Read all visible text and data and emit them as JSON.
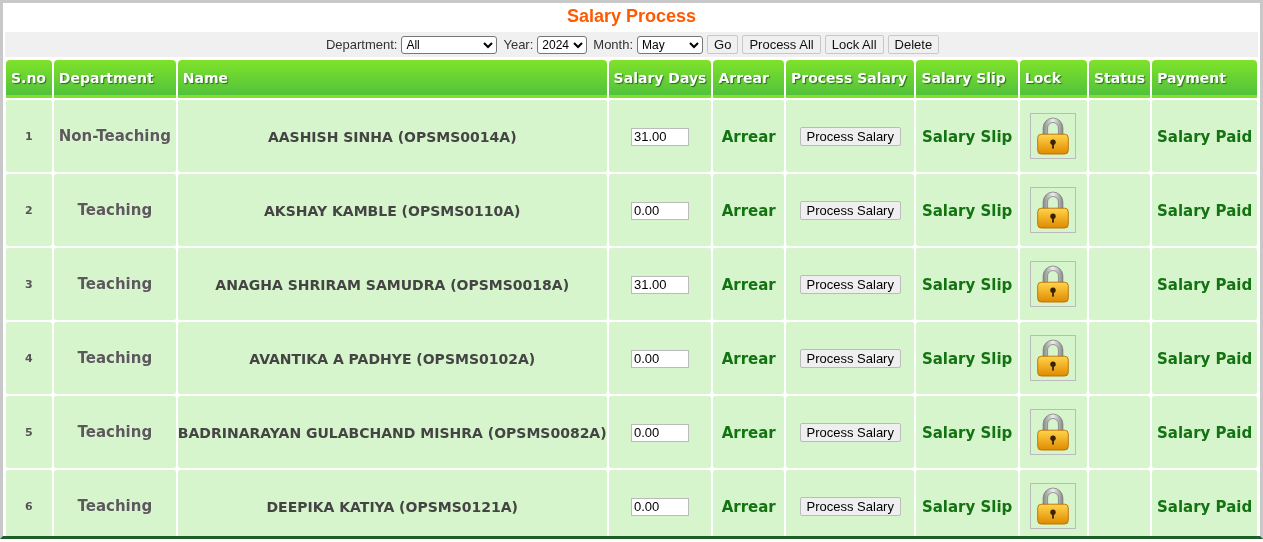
{
  "title": "Salary Process",
  "filters": [
    {
      "label": "Department:",
      "value": "All",
      "kind": "wide"
    },
    {
      "label": "Year:",
      "value": "2024",
      "kind": "narrow"
    },
    {
      "label": "Month:",
      "value": "May",
      "kind": "medium"
    }
  ],
  "buttons": [
    "Go",
    "Process All",
    "Lock All",
    "Delete"
  ],
  "table": {
    "columns": [
      "S.no",
      "Department",
      "Name",
      "Salary Days",
      "Arrear",
      "Process Salary",
      "Salary Slip",
      "Lock",
      "Status",
      "Payment"
    ],
    "rows": [
      {
        "sno": "1",
        "department": "Non-Teaching",
        "name": "AASHISH SINHA (OPSMS0014A)",
        "salary_days": "31.00",
        "arrear": "Arrear",
        "process": "Process Salary",
        "salary_slip": "Salary Slip",
        "payment": "Salary Paid"
      },
      {
        "sno": "2",
        "department": "Teaching",
        "name": "AKSHAY KAMBLE (OPSMS0110A)",
        "salary_days": "0.00",
        "arrear": "Arrear",
        "process": "Process Salary",
        "salary_slip": "Salary Slip",
        "payment": "Salary Paid"
      },
      {
        "sno": "3",
        "department": "Teaching",
        "name": "ANAGHA SHRIRAM SAMUDRA (OPSMS0018A)",
        "salary_days": "31.00",
        "arrear": "Arrear",
        "process": "Process Salary",
        "salary_slip": "Salary Slip",
        "payment": "Salary Paid"
      },
      {
        "sno": "4",
        "department": "Teaching",
        "name": "AVANTIKA A PADHYE (OPSMS0102A)",
        "salary_days": "0.00",
        "arrear": "Arrear",
        "process": "Process Salary",
        "salary_slip": "Salary Slip",
        "payment": "Salary Paid"
      },
      {
        "sno": "5",
        "department": "Teaching",
        "name": "BADRINARAYAN GULABCHAND MISHRA (OPSMS0082A)",
        "salary_days": "0.00",
        "arrear": "Arrear",
        "process": "Process Salary",
        "salary_slip": "Salary Slip",
        "payment": "Salary Paid"
      },
      {
        "sno": "6",
        "department": "Teaching",
        "name": "DEEPIKA KATIYA (OPSMS0121A)",
        "salary_days": "0.00",
        "arrear": "Arrear",
        "process": "Process Salary",
        "salary_slip": "Salary Slip",
        "payment": "Salary Paid"
      }
    ]
  }
}
